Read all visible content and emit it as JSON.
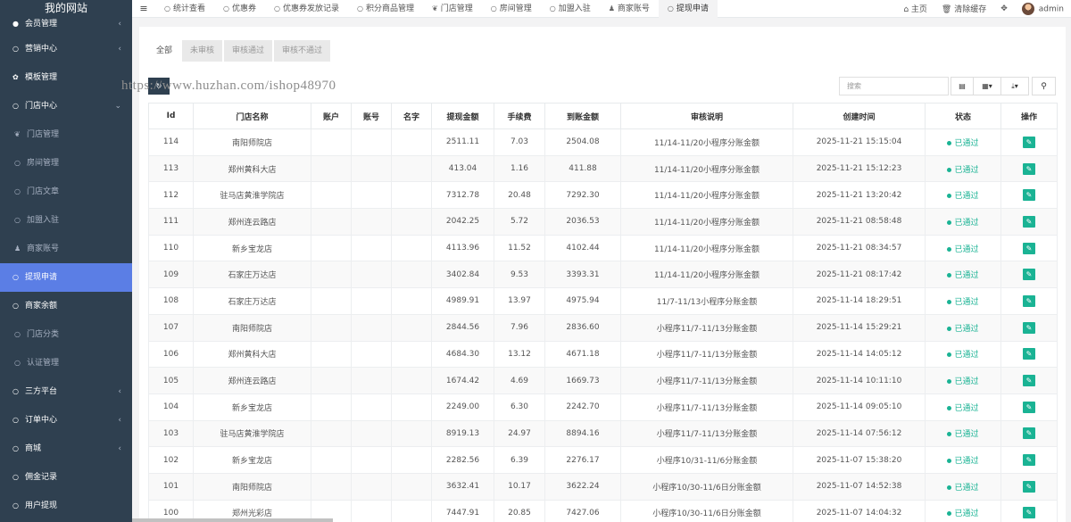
{
  "sidebar": {
    "brand": "我的网站",
    "items": [
      {
        "label": "会员管理",
        "icon": "user-circle-icon",
        "glyph": "●",
        "sub": false,
        "chevron": true,
        "cut": true
      },
      {
        "label": "营销中心",
        "icon": "circle-icon",
        "glyph": "○",
        "sub": false,
        "chevron": true
      },
      {
        "label": "模板管理",
        "icon": "gear-icon",
        "glyph": "✿",
        "sub": false,
        "chevron": false
      },
      {
        "label": "门店中心",
        "icon": "circle-icon",
        "glyph": "○",
        "sub": false,
        "chevron": "down"
      },
      {
        "label": "门店管理",
        "icon": "leaf-icon",
        "glyph": "❦",
        "sub": true
      },
      {
        "label": "房间管理",
        "icon": "circle-icon",
        "glyph": "○",
        "sub": true
      },
      {
        "label": "门店文章",
        "icon": "circle-icon",
        "glyph": "○",
        "sub": true
      },
      {
        "label": "加盟入驻",
        "icon": "circle-icon",
        "glyph": "○",
        "sub": true
      },
      {
        "label": "商家账号",
        "icon": "user-icon",
        "glyph": "♟",
        "sub": true
      },
      {
        "label": "提现申请",
        "icon": "circle-icon",
        "glyph": "○",
        "sub": false,
        "active": true
      },
      {
        "label": "商家余额",
        "icon": "circle-icon",
        "glyph": "○",
        "sub": false
      },
      {
        "label": "门店分类",
        "icon": "circle-icon",
        "glyph": "○",
        "sub": true
      },
      {
        "label": "认证管理",
        "icon": "circle-icon",
        "glyph": "○",
        "sub": true
      },
      {
        "label": "三方平台",
        "icon": "circle-icon",
        "glyph": "○",
        "sub": false,
        "chevron": true
      },
      {
        "label": "订单中心",
        "icon": "circle-icon",
        "glyph": "○",
        "sub": false,
        "chevron": true
      },
      {
        "label": "商城",
        "icon": "circle-icon",
        "glyph": "○",
        "sub": false,
        "chevron": true
      },
      {
        "label": "佣金记录",
        "icon": "circle-icon",
        "glyph": "○",
        "sub": false
      },
      {
        "label": "用户提现",
        "icon": "circle-icon",
        "glyph": "○",
        "sub": false
      }
    ]
  },
  "topbar": {
    "menu_icon": "≡",
    "tabs": [
      {
        "label": "统计查看",
        "icon": "circle-icon",
        "glyph": "○"
      },
      {
        "label": "优惠券",
        "icon": "circle-icon",
        "glyph": "○"
      },
      {
        "label": "优惠券发放记录",
        "icon": "circle-icon",
        "glyph": "○"
      },
      {
        "label": "积分商品管理",
        "icon": "circle-icon",
        "glyph": "○"
      },
      {
        "label": "门店管理",
        "icon": "leaf-icon",
        "glyph": "❦"
      },
      {
        "label": "房间管理",
        "icon": "circle-icon",
        "glyph": "○"
      },
      {
        "label": "加盟入驻",
        "icon": "circle-icon",
        "glyph": "○"
      },
      {
        "label": "商家账号",
        "icon": "user-icon",
        "glyph": "♟"
      },
      {
        "label": "提现申请",
        "icon": "circle-icon",
        "glyph": "○",
        "active": true
      }
    ],
    "home": "主页",
    "clear_cache": "清除缓存",
    "user": "admin"
  },
  "filters": {
    "tabs": [
      {
        "label": "全部",
        "active": true
      },
      {
        "label": "未审核"
      },
      {
        "label": "审核通过"
      },
      {
        "label": "审核不通过"
      }
    ]
  },
  "watermark": "https://www.huzhan.com/ishop48970",
  "search": {
    "placeholder": "搜索"
  },
  "table": {
    "columns": [
      "Id",
      "门店名称",
      "账户",
      "账号",
      "名字",
      "提现金额",
      "手续费",
      "到账金额",
      "审核说明",
      "创建时间",
      "状态",
      "操作"
    ],
    "rows": [
      {
        "id": "114",
        "store": "南阳师院店",
        "amount": "2511.11",
        "fee": "7.03",
        "received": "2504.08",
        "note": "11/14-11/20小程序分账金额",
        "time": "2025-11-21 15:15:04",
        "status": "已通过"
      },
      {
        "id": "113",
        "store": "郑州黄科大店",
        "amount": "413.04",
        "fee": "1.16",
        "received": "411.88",
        "note": "11/14-11/20小程序分账金额",
        "time": "2025-11-21 15:12:23",
        "status": "已通过"
      },
      {
        "id": "112",
        "store": "驻马店黄淮学院店",
        "amount": "7312.78",
        "fee": "20.48",
        "received": "7292.30",
        "note": "11/14-11/20小程序分账金额",
        "time": "2025-11-21 13:20:42",
        "status": "已通过"
      },
      {
        "id": "111",
        "store": "郑州连云路店",
        "amount": "2042.25",
        "fee": "5.72",
        "received": "2036.53",
        "note": "11/14-11/20小程序分账金额",
        "time": "2025-11-21 08:58:48",
        "status": "已通过"
      },
      {
        "id": "110",
        "store": "新乡宝龙店",
        "amount": "4113.96",
        "fee": "11.52",
        "received": "4102.44",
        "note": "11/14-11/20小程序分账金额",
        "time": "2025-11-21 08:34:57",
        "status": "已通过"
      },
      {
        "id": "109",
        "store": "石家庄万达店",
        "amount": "3402.84",
        "fee": "9.53",
        "received": "3393.31",
        "note": "11/14-11/20小程序分账金额",
        "time": "2025-11-21 08:17:42",
        "status": "已通过"
      },
      {
        "id": "108",
        "store": "石家庄万达店",
        "amount": "4989.91",
        "fee": "13.97",
        "received": "4975.94",
        "note": "11/7-11/13小程序分账金额",
        "time": "2025-11-14 18:29:51",
        "status": "已通过"
      },
      {
        "id": "107",
        "store": "南阳师院店",
        "amount": "2844.56",
        "fee": "7.96",
        "received": "2836.60",
        "note": "小程序11/7-11/13分账金额",
        "time": "2025-11-14 15:29:21",
        "status": "已通过"
      },
      {
        "id": "106",
        "store": "郑州黄科大店",
        "amount": "4684.30",
        "fee": "13.12",
        "received": "4671.18",
        "note": "小程序11/7-11/13分账金额",
        "time": "2025-11-14 14:05:12",
        "status": "已通过"
      },
      {
        "id": "105",
        "store": "郑州连云路店",
        "amount": "1674.42",
        "fee": "4.69",
        "received": "1669.73",
        "note": "小程序11/7-11/13分账金额",
        "time": "2025-11-14 10:11:10",
        "status": "已通过"
      },
      {
        "id": "104",
        "store": "新乡宝龙店",
        "amount": "2249.00",
        "fee": "6.30",
        "received": "2242.70",
        "note": "小程序11/7-11/13分账金额",
        "time": "2025-11-14 09:05:10",
        "status": "已通过"
      },
      {
        "id": "103",
        "store": "驻马店黄淮学院店",
        "amount": "8919.13",
        "fee": "24.97",
        "received": "8894.16",
        "note": "小程序11/7-11/13分账金额",
        "time": "2025-11-14 07:56:12",
        "status": "已通过"
      },
      {
        "id": "102",
        "store": "新乡宝龙店",
        "amount": "2282.56",
        "fee": "6.39",
        "received": "2276.17",
        "note": "小程序10/31-11/6分账金额",
        "time": "2025-11-07 15:38:20",
        "status": "已通过"
      },
      {
        "id": "101",
        "store": "南阳师院店",
        "amount": "3632.41",
        "fee": "10.17",
        "received": "3622.24",
        "note": "小程序10/30-11/6日分账金额",
        "time": "2025-11-07 14:52:38",
        "status": "已通过"
      },
      {
        "id": "100",
        "store": "郑州光彩店",
        "amount": "7447.91",
        "fee": "20.85",
        "received": "7427.06",
        "note": "小程序10/30-11/6日分账金额",
        "time": "2025-11-07 14:04:32",
        "status": "已通过"
      }
    ]
  },
  "colors": {
    "sidebar": "#2f4050",
    "active": "#5b7ee5",
    "success": "#1ab394"
  }
}
